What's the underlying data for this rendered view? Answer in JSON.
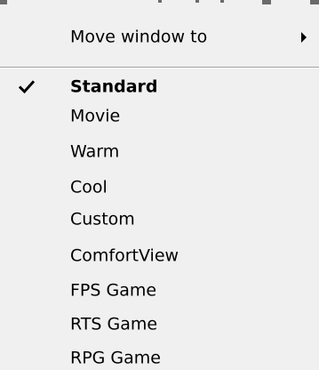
{
  "menu": {
    "move_window": {
      "label": "Move window to",
      "icon": "chevron-right-icon"
    },
    "items": [
      {
        "label": "Standard",
        "checked": true
      },
      {
        "label": "Movie",
        "checked": false
      },
      {
        "label": "Warm",
        "checked": false
      },
      {
        "label": "Cool",
        "checked": false
      },
      {
        "label": "Custom",
        "checked": false
      },
      {
        "label": "ComfortView",
        "checked": false
      },
      {
        "label": "FPS Game",
        "checked": false
      },
      {
        "label": "RTS Game",
        "checked": false
      },
      {
        "label": "RPG Game",
        "checked": false
      }
    ],
    "check_icon": "checkmark-icon"
  },
  "colors": {
    "background": "#f0f0f0",
    "text": "#000000",
    "separator_dark": "#a0a0a0",
    "separator_light": "#ffffff"
  }
}
